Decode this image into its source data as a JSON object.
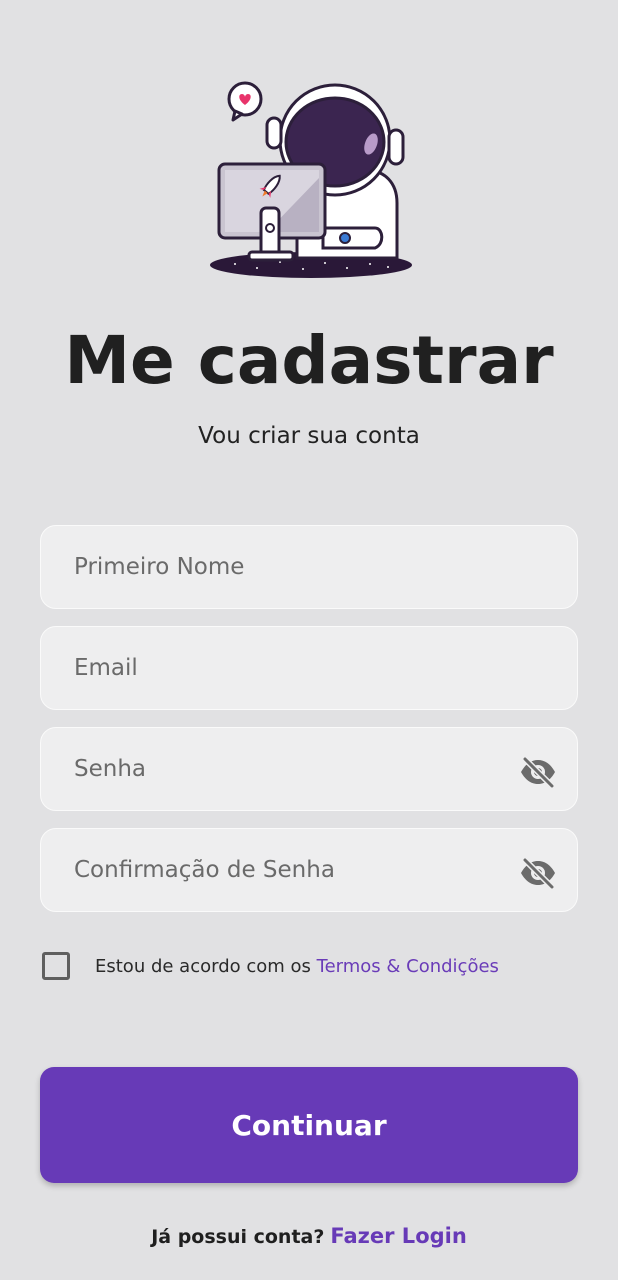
{
  "header": {
    "illustration": "astronaut-at-computer-illustration",
    "title": "Me cadastrar",
    "subtitle": "Vou criar sua conta"
  },
  "form": {
    "first_name": {
      "placeholder": "Primeiro Nome",
      "value": ""
    },
    "email": {
      "placeholder": "Email",
      "value": ""
    },
    "password": {
      "placeholder": "Senha",
      "value": "",
      "icon": "eye-off-icon"
    },
    "password_confirm": {
      "placeholder": "Confirmação de Senha",
      "value": "",
      "icon": "eye-off-icon"
    }
  },
  "terms": {
    "checked": false,
    "text": "Estou de acordo com os ",
    "link": "Termos & Condições"
  },
  "submit": {
    "label": "Continuar"
  },
  "footer": {
    "question": "Já possui conta?",
    "link": "Fazer Login"
  },
  "colors": {
    "background": "#e1e1e3",
    "accent": "#673ab7",
    "field_bg": "#eeeeef"
  }
}
